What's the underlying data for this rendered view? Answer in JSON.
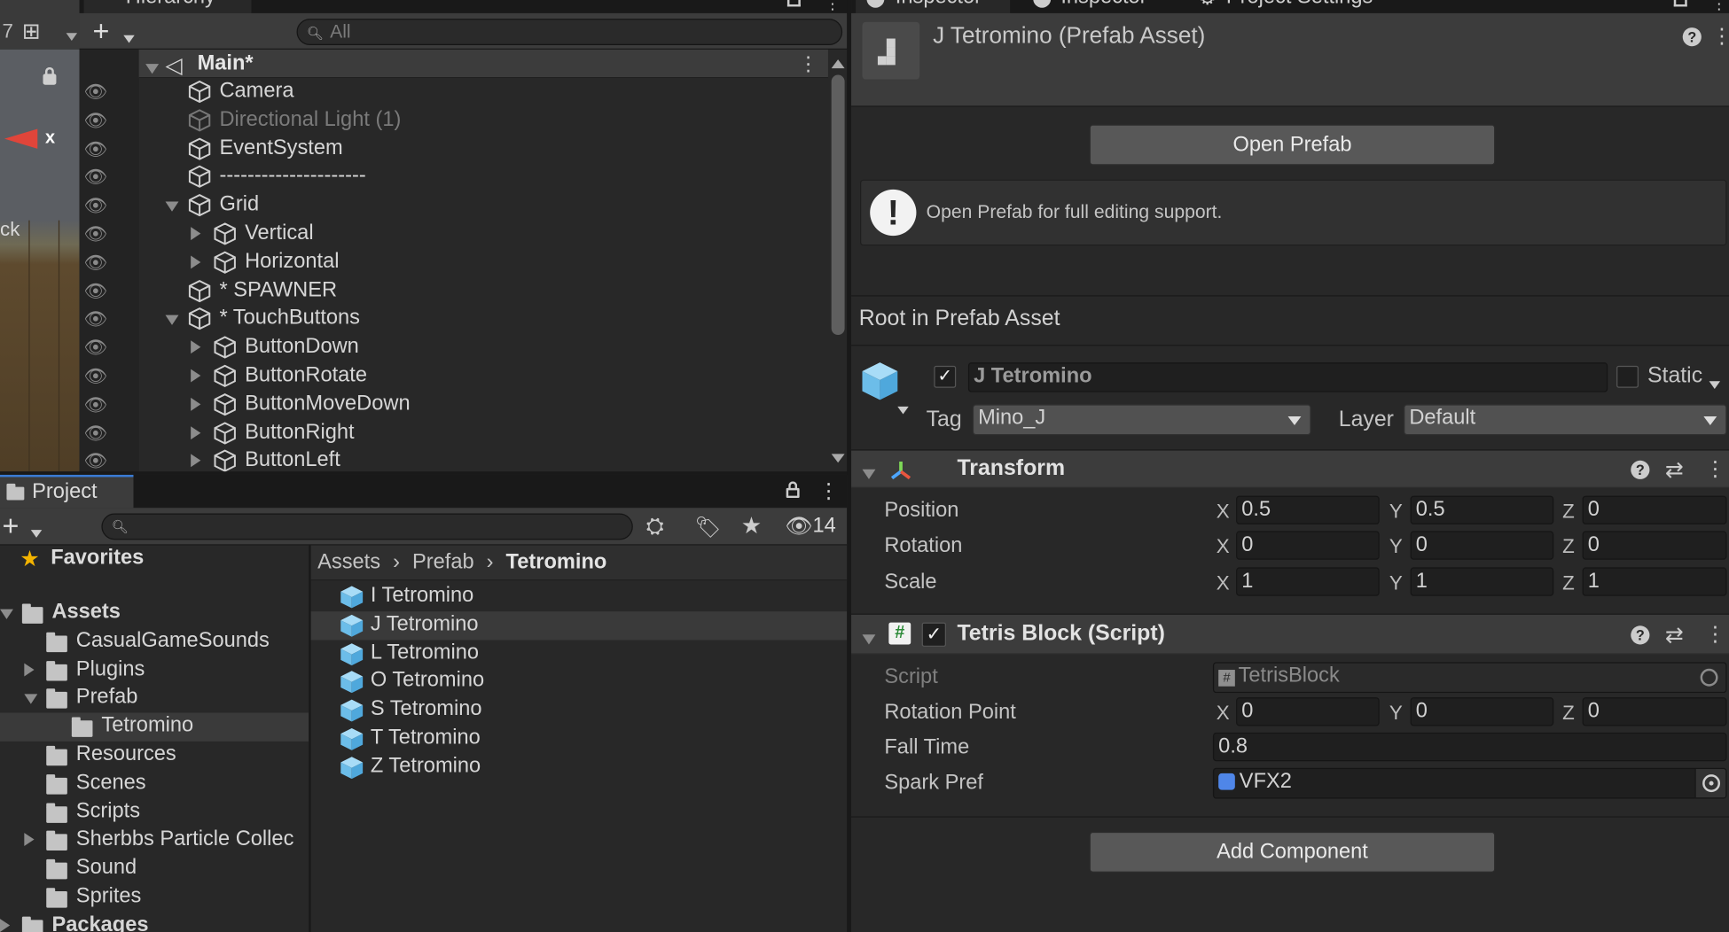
{
  "hierarchy": {
    "tab_label": "Hierarchy",
    "search_placeholder": "All",
    "scene_name": "Main*",
    "items": [
      {
        "label": "Camera",
        "depth": 1,
        "expander": "none",
        "disabled": false
      },
      {
        "label": "Directional Light (1)",
        "depth": 1,
        "expander": "none",
        "disabled": true
      },
      {
        "label": "EventSystem",
        "depth": 1,
        "expander": "none",
        "disabled": false
      },
      {
        "label": "---------------------",
        "depth": 1,
        "expander": "none",
        "disabled": false
      },
      {
        "label": "Grid",
        "depth": 1,
        "expander": "open",
        "disabled": false
      },
      {
        "label": "Vertical",
        "depth": 2,
        "expander": "closed",
        "disabled": false
      },
      {
        "label": "Horizontal",
        "depth": 2,
        "expander": "closed",
        "disabled": false
      },
      {
        "label": "* SPAWNER",
        "depth": 1,
        "expander": "none",
        "disabled": false
      },
      {
        "label": "* TouchButtons",
        "depth": 1,
        "expander": "open",
        "disabled": false
      },
      {
        "label": "ButtonDown",
        "depth": 2,
        "expander": "closed",
        "disabled": false
      },
      {
        "label": "ButtonRotate",
        "depth": 2,
        "expander": "closed",
        "disabled": false
      },
      {
        "label": "ButtonMoveDown",
        "depth": 2,
        "expander": "closed",
        "disabled": false
      },
      {
        "label": "ButtonRight",
        "depth": 2,
        "expander": "closed",
        "disabled": false
      },
      {
        "label": "ButtonLeft",
        "depth": 2,
        "expander": "closed",
        "disabled": false
      }
    ]
  },
  "scene_strip": {
    "gizmo_x_label": "x",
    "partial_text": "ck"
  },
  "project": {
    "tab_label": "Project",
    "hidden_count": "14",
    "favorites_label": "Favorites",
    "tree": [
      {
        "label": "Assets",
        "depth": 0,
        "expander": "open",
        "selected": false
      },
      {
        "label": "CasualGameSounds",
        "depth": 1,
        "expander": "none",
        "selected": false
      },
      {
        "label": "Plugins",
        "depth": 1,
        "expander": "closed",
        "selected": false
      },
      {
        "label": "Prefab",
        "depth": 1,
        "expander": "open",
        "selected": false
      },
      {
        "label": "Tetromino",
        "depth": 2,
        "expander": "none",
        "selected": true
      },
      {
        "label": "Resources",
        "depth": 1,
        "expander": "none",
        "selected": false
      },
      {
        "label": "Scenes",
        "depth": 1,
        "expander": "none",
        "selected": false
      },
      {
        "label": "Scripts",
        "depth": 1,
        "expander": "none",
        "selected": false
      },
      {
        "label": "Sherbbs Particle Collec",
        "depth": 1,
        "expander": "closed",
        "selected": false
      },
      {
        "label": "Sound",
        "depth": 1,
        "expander": "none",
        "selected": false
      },
      {
        "label": "Sprites",
        "depth": 1,
        "expander": "none",
        "selected": false
      },
      {
        "label": "Packages",
        "depth": 0,
        "expander": "closed",
        "selected": false
      }
    ],
    "breadcrumb": [
      "Assets",
      "Prefab",
      "Tetromino"
    ],
    "assets": [
      {
        "label": "I Tetromino",
        "selected": false
      },
      {
        "label": "J Tetromino",
        "selected": true
      },
      {
        "label": "L Tetromino",
        "selected": false
      },
      {
        "label": "O Tetromino",
        "selected": false
      },
      {
        "label": "S Tetromino",
        "selected": false
      },
      {
        "label": "T Tetromino",
        "selected": false
      },
      {
        "label": "Z Tetromino",
        "selected": false
      }
    ]
  },
  "inspector": {
    "tabs": [
      "Inspector",
      "Inspector",
      "Project Settings"
    ],
    "title": "J Tetromino (Prefab Asset)",
    "open_prefab": "Open Prefab",
    "info_message": "Open Prefab for full editing support.",
    "root_label": "Root in Prefab Asset",
    "object_name": "J Tetromino",
    "static_label": "Static",
    "tag_label": "Tag",
    "tag_value": "Mino_J",
    "layer_label": "Layer",
    "layer_value": "Default",
    "transform": {
      "title": "Transform",
      "rows": [
        {
          "label": "Position",
          "x": "0.5",
          "y": "0.5",
          "z": "0"
        },
        {
          "label": "Rotation",
          "x": "0",
          "y": "0",
          "z": "0"
        },
        {
          "label": "Scale",
          "x": "1",
          "y": "1",
          "z": "1"
        }
      ]
    },
    "script_component": {
      "title": "Tetris Block (Script)",
      "script_label": "Script",
      "script_value": "TetrisBlock",
      "rotation_point_label": "Rotation Point",
      "rotation_point": {
        "x": "0",
        "y": "0",
        "z": "0"
      },
      "fall_time_label": "Fall Time",
      "fall_time": "0.8",
      "spark_pref_label": "Spark Pref",
      "spark_pref": "VFX2"
    },
    "axis_labels": {
      "x": "X",
      "y": "Y",
      "z": "Z"
    },
    "add_component": "Add Component"
  },
  "colors": {
    "cube_blue": "#7ec8ef",
    "selection": "#3a3a3a",
    "accent_star": "#f4b400"
  }
}
